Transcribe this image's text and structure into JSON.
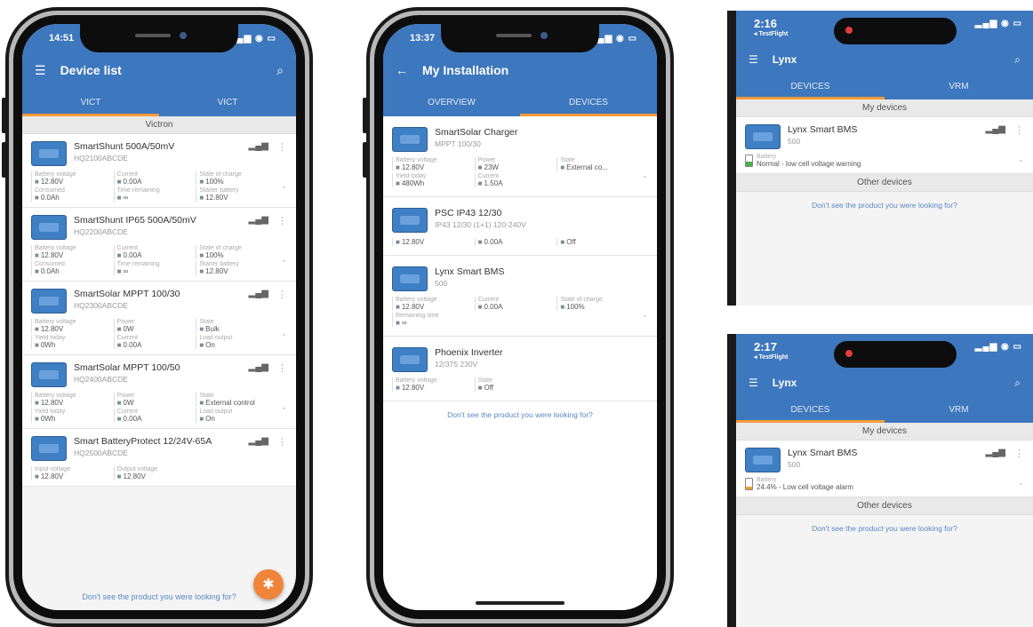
{
  "colors": {
    "brand_blue": "#3d77bd",
    "accent_orange": "#f59a3a",
    "fab_orange": "#f0853a",
    "link_blue": "#5a88c4"
  },
  "phone1": {
    "status_time": "14:51",
    "title": "Device list",
    "tabs": [
      "Vict",
      "Vict"
    ],
    "section": "Victron",
    "devices": [
      {
        "name": "SmartShunt 500A/50mV",
        "model": "HQ2100ABCDE",
        "fields": [
          {
            "label": "Battery voltage",
            "value": "12.80V"
          },
          {
            "label": "Current",
            "value": "0.00A"
          },
          {
            "label": "State of charge",
            "value": "100%"
          },
          {
            "label": "Consumed",
            "value": "0.0Ah"
          },
          {
            "label": "Time remaining",
            "value": "∞"
          },
          {
            "label": "Starter battery",
            "value": "12.80V"
          }
        ]
      },
      {
        "name": "SmartShunt IP65 500A/50mV",
        "model": "HQ2200ABCDE",
        "fields": [
          {
            "label": "Battery voltage",
            "value": "12.80V"
          },
          {
            "label": "Current",
            "value": "0.00A"
          },
          {
            "label": "State of charge",
            "value": "100%"
          },
          {
            "label": "Consumed",
            "value": "0.0Ah"
          },
          {
            "label": "Time remaining",
            "value": "∞"
          },
          {
            "label": "Starter battery",
            "value": "12.80V"
          }
        ]
      },
      {
        "name": "SmartSolar MPPT 100/30",
        "model": "HQ2300ABCDE",
        "fields": [
          {
            "label": "Battery voltage",
            "value": "12.80V"
          },
          {
            "label": "Power",
            "value": "0W"
          },
          {
            "label": "State",
            "value": "Bulk"
          },
          {
            "label": "Yield today",
            "value": "0Wh"
          },
          {
            "label": "Current",
            "value": "0.00A"
          },
          {
            "label": "Load output",
            "value": "On"
          }
        ]
      },
      {
        "name": "SmartSolar MPPT 100/50",
        "model": "HQ2400ABCDE",
        "fields": [
          {
            "label": "Battery voltage",
            "value": "12.80V"
          },
          {
            "label": "Power",
            "value": "0W"
          },
          {
            "label": "State",
            "value": "External control"
          },
          {
            "label": "Yield today",
            "value": "0Wh"
          },
          {
            "label": "Current",
            "value": "0.00A"
          },
          {
            "label": "Load output",
            "value": "On"
          }
        ]
      },
      {
        "name": "Smart BatteryProtect 12/24V-65A",
        "model": "HQ2500ABCDE",
        "fields": [
          {
            "label": "Input voltage",
            "value": "12.80V"
          },
          {
            "label": "Output voltage",
            "value": "12.80V"
          }
        ]
      }
    ],
    "hint": "Don't see the product you were looking for?",
    "fab_icon": "bluetooth-icon"
  },
  "phone2": {
    "status_time": "13:37",
    "title": "My Installation",
    "tabs": [
      "Overview",
      "Devices"
    ],
    "devices": [
      {
        "name": "SmartSolar Charger",
        "model": "MPPT 100/30",
        "fields": [
          {
            "label": "Battery voltage",
            "value": "12.80V"
          },
          {
            "label": "Power",
            "value": "23W"
          },
          {
            "label": "State",
            "value": "External co..."
          },
          {
            "label": "Yield today",
            "value": "480Wh"
          },
          {
            "label": "Current",
            "value": "1.50A"
          }
        ]
      },
      {
        "name": "PSC IP43 12/30",
        "model": "IP43 12/30 (1+1) 120-240V",
        "fields": [
          {
            "label": "",
            "value": "12.80V"
          },
          {
            "label": "",
            "value": "0.00A"
          },
          {
            "label": "",
            "value": "Off"
          }
        ]
      },
      {
        "name": "Lynx Smart BMS",
        "model": "500",
        "fields": [
          {
            "label": "Battery voltage",
            "value": "12.80V"
          },
          {
            "label": "Current",
            "value": "0.00A"
          },
          {
            "label": "State of charge",
            "value": "100%"
          },
          {
            "label": "Remaining time",
            "value": "∞"
          }
        ]
      },
      {
        "name": "Phoenix Inverter",
        "model": "12/375 230V",
        "fields": [
          {
            "label": "Battery voltage",
            "value": "12.80V"
          },
          {
            "label": "State",
            "value": "Off"
          }
        ]
      }
    ],
    "hint": "Don't see the product you were looking for?"
  },
  "crop1": {
    "status_time": "2:16",
    "status_sub": "◂ TestFlight",
    "title": "Lynx",
    "tabs": [
      "Devices",
      "Vrm"
    ],
    "section": "My devices",
    "device": {
      "name": "Lynx Smart BMS",
      "model": "500",
      "status_label": "Battery",
      "status_value": "Normal - low cell voltage warning"
    },
    "other_section": "Other devices",
    "hint": "Don't see the product you were looking for?"
  },
  "crop2": {
    "status_time": "2:17",
    "status_sub": "◂ TestFlight",
    "title": "Lynx",
    "tabs": [
      "Devices",
      "Vrm"
    ],
    "section": "My devices",
    "device": {
      "name": "Lynx Smart BMS",
      "model": "500",
      "status_label": "Battery",
      "status_value": "24.4% - Low cell voltage alarm"
    },
    "other_section": "Other devices",
    "hint": "Don't see the product you were looking for?"
  }
}
